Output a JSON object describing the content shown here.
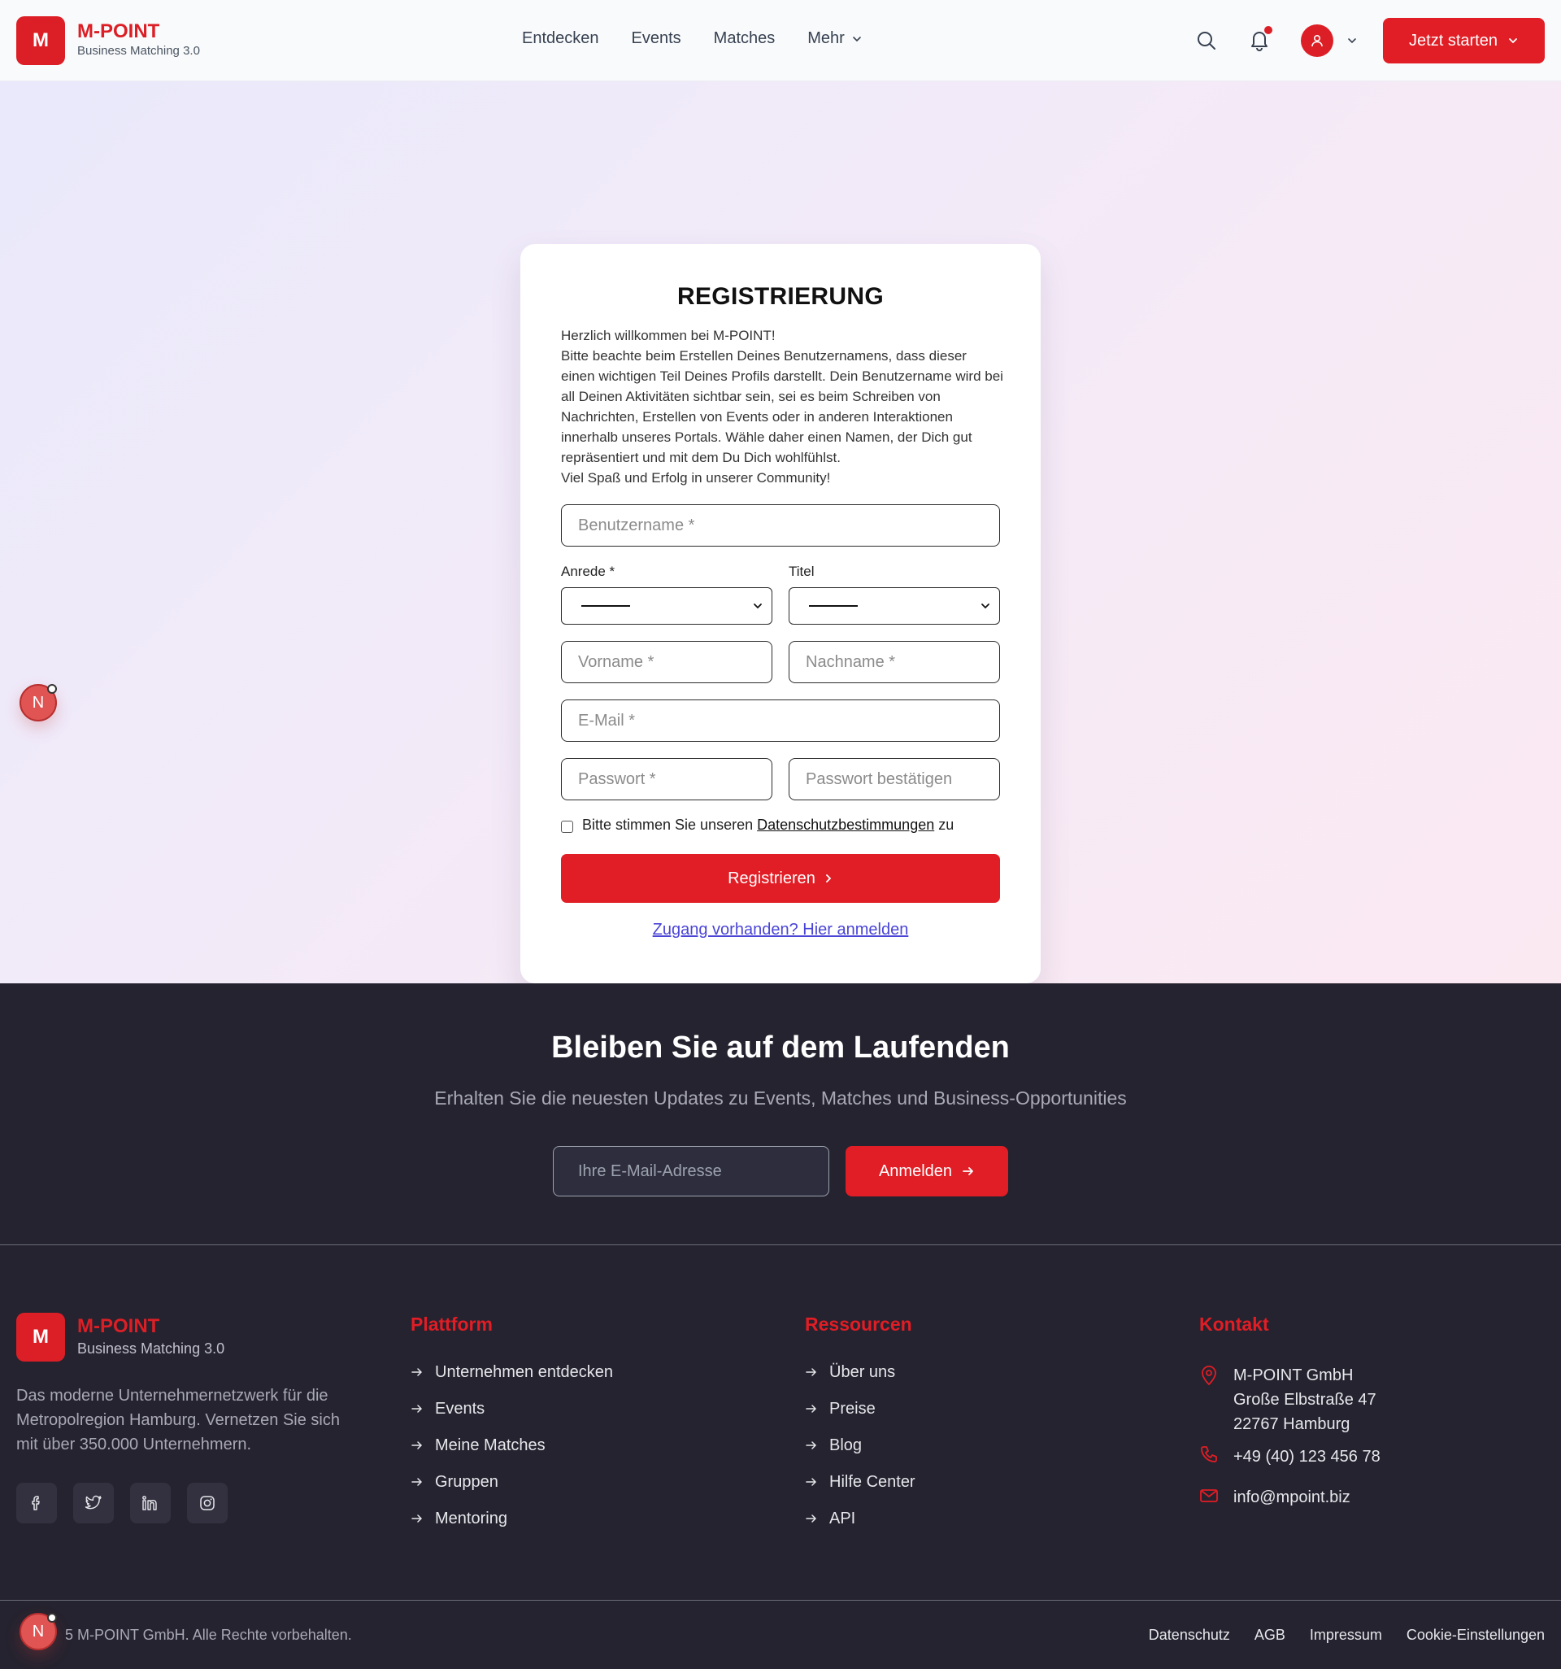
{
  "header": {
    "logo_letter": "M",
    "brand_name": "M-POINT",
    "brand_sub": "Business Matching 3.0",
    "nav": [
      "Entdecken",
      "Events",
      "Matches",
      "Mehr"
    ],
    "cta": "Jetzt starten"
  },
  "register": {
    "title": "REGISTRIERUNG",
    "intro": [
      "Herzlich willkommen bei M-POINT!",
      "Bitte beachte beim Erstellen Deines Benutzernamens, dass dieser einen wichtigen Teil Deines Profils darstellt. Dein Benutzername wird bei all Deinen Aktivitäten sichtbar sein, sei es beim Schreiben von Nachrichten, Erstellen von Events oder in anderen Interaktionen innerhalb unseres Portals. Wähle daher einen Namen, der Dich gut repräsentiert und mit dem Du Dich wohlfühlst.",
      "Viel Spaß und Erfolg in unserer Community!"
    ],
    "username_placeholder": "Benutzername *",
    "anrede_label": "Anrede *",
    "titel_label": "Titel",
    "firstname_placeholder": "Vorname *",
    "lastname_placeholder": "Nachname *",
    "email_placeholder": "E-Mail *",
    "password_placeholder": "Passwort *",
    "password_confirm_placeholder": "Passwort bestätigen",
    "consent_pre": "Bitte stimmen Sie unseren ",
    "consent_link": "Datenschutzbestimmungen",
    "consent_post": " zu",
    "submit": "Registrieren",
    "login_link": "Zugang vorhanden? Hier anmelden"
  },
  "floating": {
    "letter": "N"
  },
  "newsletter": {
    "title": "Bleiben Sie auf dem Laufenden",
    "subtitle": "Erhalten Sie die neuesten Updates zu Events, Matches und Business-Opportunities",
    "email_placeholder": "Ihre E-Mail-Adresse",
    "button": "Anmelden"
  },
  "footer": {
    "brand_name": "M-POINT",
    "brand_sub": "Business Matching 3.0",
    "description": "Das moderne Unternehmernetzwerk für die Metropolregion Hamburg. Vernetzen Sie sich mit über 350.000 Unternehmern.",
    "social_icons": [
      "facebook-icon",
      "twitter-icon",
      "linkedin-icon",
      "instagram-icon"
    ],
    "platform_title": "Plattform",
    "platform_links": [
      "Unternehmen entdecken",
      "Events",
      "Meine Matches",
      "Gruppen",
      "Mentoring"
    ],
    "resources_title": "Ressourcen",
    "resources_links": [
      "Über uns",
      "Preise",
      "Blog",
      "Hilfe Center",
      "API"
    ],
    "contact_title": "Kontakt",
    "address_line1": "M-POINT GmbH",
    "address_line2": "Große Elbstraße 47",
    "address_line3": "22767 Hamburg",
    "phone": "+49 (40) 123 456 78",
    "email": "info@mpoint.biz",
    "copyright": "5 M-POINT GmbH. Alle Rechte vorbehalten.",
    "legal_links": [
      "Datenschutz",
      "AGB",
      "Impressum",
      "Cookie-Einstellungen"
    ]
  },
  "colors": {
    "brand_red": "#e11d25",
    "footer_bg": "#25232f",
    "link_blue": "#4a45d6"
  }
}
